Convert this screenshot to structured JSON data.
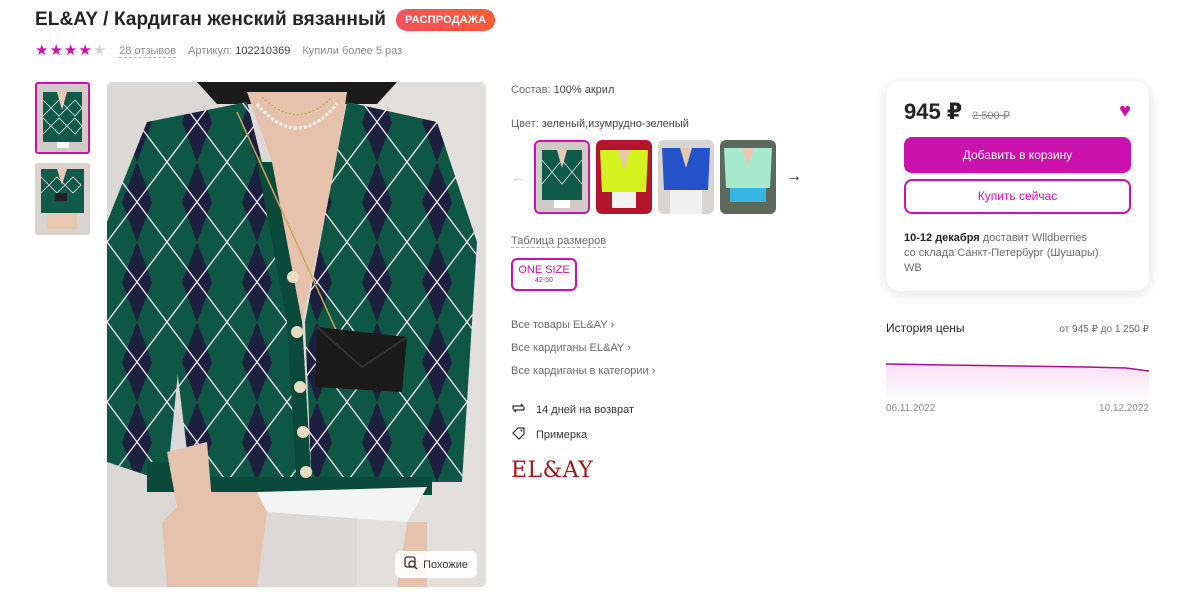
{
  "product": {
    "title": "EL&AY / Кардиган женский вязанный",
    "badge": "РАСПРОДАЖА",
    "rating": 4,
    "reviews": "28 отзывов",
    "article_label": "Артикул:",
    "article_value": "102210369",
    "bought": "Купили более 5 раз"
  },
  "gallery": {
    "similar_label": "Похожие"
  },
  "info": {
    "composition_label": "Состав:",
    "composition_value": "100% акрил",
    "color_label": "Цвет:",
    "color_value": "зеленый,изумрудно-зеленый",
    "size_table": "Таблица размеров",
    "size_main": "ONE SIZE",
    "size_sub": "42-50",
    "links": [
      "Все товары EL&AY",
      "Все кардиганы EL&AY",
      "Все кардиганы в категории"
    ],
    "return": "14 дней на возврат",
    "fitting": "Примерка",
    "brand_logo": "EL&AY"
  },
  "price_card": {
    "price": "945 ₽",
    "old_price": "2 500 ₽",
    "add_to_cart": "Добавить в корзину",
    "buy_now": "Купить сейчас",
    "delivery_date": "10-12 декабря",
    "delivery_text": "доставит Wildberries",
    "warehouse": "со склада Санкт-Петербург (Шушары)",
    "seller": "WB"
  },
  "price_history": {
    "title": "История цены",
    "range": "от 945 ₽ до 1 250 ₽",
    "start_date": "06.11.2022",
    "end_date": "10.12.2022"
  },
  "colors": {
    "accent": "#cb11ab",
    "sale": "#f5515f"
  }
}
